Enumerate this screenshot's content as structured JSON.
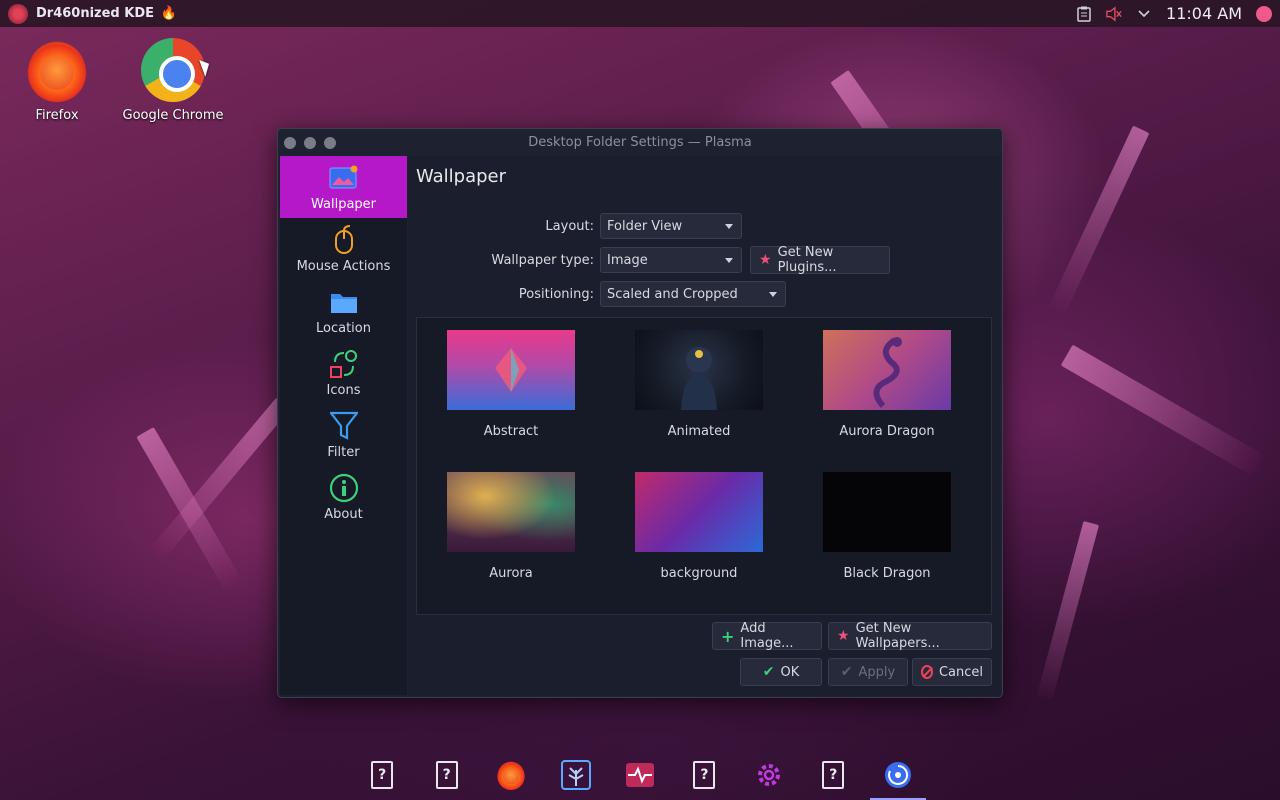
{
  "panel": {
    "title": "Dr460nized KDE",
    "title_emoji": "🔥",
    "clock": "11:04 AM"
  },
  "desktop": {
    "icons": [
      {
        "label": "Firefox",
        "icon": "firefox-icon"
      },
      {
        "label": "Google Chrome",
        "icon": "chrome-icon"
      }
    ]
  },
  "window": {
    "title": "Desktop Folder Settings — Plasma",
    "sidebar": [
      {
        "label": "Wallpaper",
        "icon": "wallpaper-icon",
        "active": true
      },
      {
        "label": "Mouse Actions",
        "icon": "mouse-icon"
      },
      {
        "label": "Location",
        "icon": "folder-icon"
      },
      {
        "label": "Icons",
        "icon": "icons-icon"
      },
      {
        "label": "Filter",
        "icon": "filter-icon"
      },
      {
        "label": "About",
        "icon": "info-icon"
      }
    ],
    "page_title": "Wallpaper",
    "layout": {
      "label": "Layout:",
      "value": "Folder View"
    },
    "wallpaper_type": {
      "label": "Wallpaper type:",
      "value": "Image"
    },
    "get_plugins": "Get New Plugins...",
    "positioning": {
      "label": "Positioning:",
      "value": "Scaled and Cropped"
    },
    "wallpapers": [
      {
        "name": "Abstract"
      },
      {
        "name": "Animated"
      },
      {
        "name": "Aurora Dragon"
      },
      {
        "name": "Aurora"
      },
      {
        "name": "background"
      },
      {
        "name": "Black Dragon"
      }
    ],
    "add_image": "Add Image...",
    "get_wallpapers": "Get New Wallpapers...",
    "ok": "OK",
    "apply": "Apply",
    "cancel": "Cancel"
  },
  "colors": {
    "accent": "#b418c8",
    "window_bg": "#1d2030"
  }
}
